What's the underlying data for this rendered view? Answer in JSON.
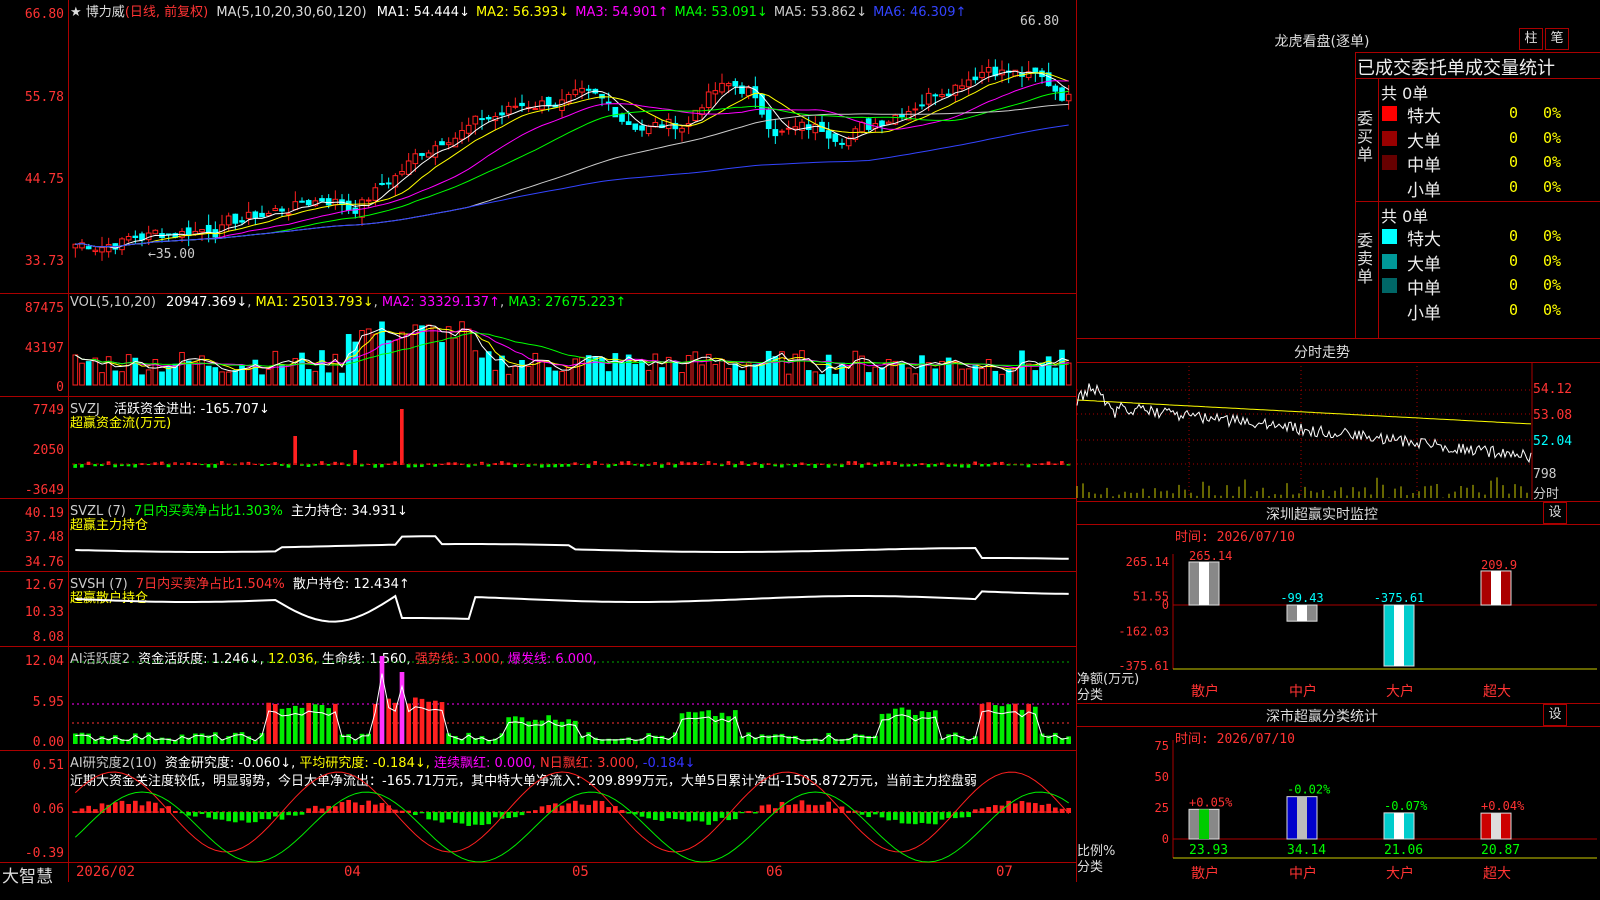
{
  "app_name": "大智慧",
  "stock": {
    "name": "博力威",
    "period": "(日线, 前复权)"
  },
  "main_panel": {
    "ma_legend": "MA(5,10,20,30,60,120)",
    "ma_items": [
      {
        "label": "MA1: 54.444↓",
        "color": "#ffffff"
      },
      {
        "label": "MA2: 56.393↓",
        "color": "#ffff00"
      },
      {
        "label": "MA3: 54.901↑",
        "color": "#ff00ff"
      },
      {
        "label": "MA4: 53.091↓",
        "color": "#00ff00"
      },
      {
        "label": "MA5: 53.862↓",
        "color": "#cccccc"
      },
      {
        "label": "MA6: 46.309↑",
        "color": "#3344ff"
      }
    ],
    "yticks": [
      "66.80",
      "55.78",
      "44.75",
      "33.73"
    ],
    "high_label": "66.80",
    "low_label": "←35.00",
    "y_range": [
      33.0,
      68.0
    ]
  },
  "vol_panel": {
    "label": "VOL(5,10,20)",
    "value": "20947.369↓",
    "ma1": "MA1: 25013.793↓",
    "ma2": "MA2: 33329.137↑",
    "ma3": "MA3: 27675.223↑",
    "yticks": [
      "87475",
      "43197",
      "0"
    ]
  },
  "svzj_panel": {
    "label": "SVZJ",
    "title": "活跃资金进出: -165.707↓",
    "subtitle": "超赢资金流(万元)",
    "yticks": [
      "7749",
      "2050",
      "-3649"
    ]
  },
  "svzl_panel": {
    "label": "SVZL (7)",
    "a": "7日内买卖净占比1.303%",
    "b": "主力持仓: 34.931↓",
    "subtitle": "超赢主力持仓",
    "yticks": [
      "40.19",
      "37.48",
      "34.76"
    ]
  },
  "svsh_panel": {
    "label": "SVSH (7)",
    "a": "7日内买卖净占比1.504%",
    "b": "散户持仓: 12.434↑",
    "subtitle": "超赢散户持仓",
    "yticks": [
      "12.67",
      "10.33",
      "8.08"
    ]
  },
  "ai_act_panel": {
    "label": "AI活跃度2",
    "a": "资金活跃度: 1.246↓,",
    "b": "12.036,",
    "c": "生命线: 1.560,",
    "d": "强势线: 3.000,",
    "e": "爆发线: 6.000,",
    "yticks": [
      "12.04",
      "5.95",
      "0.00"
    ]
  },
  "ai_res_panel": {
    "label": "AI研究度2(10)",
    "a": "资金研究度: -0.060↓,",
    "b": "平均研究度: -0.184↓,",
    "c": "连续飘红: 0.000,",
    "d": "N日飘红: 3.000,",
    "e": "-0.184↓",
    "note": "近期大资金关注度较低，明显弱势，今日大单净流出：-165.71万元，其中特大单净流入：209.899万元，大单5日累计净出-1505.872万元，当前主力控盘弱",
    "yticks": [
      "0.51",
      "0.06",
      "-0.39"
    ]
  },
  "x_labels": [
    "2026/02",
    "04",
    "05",
    "06",
    "07"
  ],
  "right_panel": {
    "longhu_title": "龙虎看盘(逐单)",
    "btn_a": "柱",
    "btn_b": "笔",
    "table_header": "已成交委托单成交量统计",
    "buy_label": "委买单",
    "sell_label": "委卖单",
    "buy_total": "共 0单",
    "sell_total": "共 0单",
    "buy_rows": [
      {
        "name": "特大",
        "n": "0",
        "p": "0%",
        "color": "#ff0000"
      },
      {
        "name": "大单",
        "n": "0",
        "p": "0%",
        "color": "#990000"
      },
      {
        "name": "中单",
        "n": "0",
        "p": "0%",
        "color": "#660000"
      },
      {
        "name": "小单",
        "n": "0",
        "p": "0%",
        "color": "#000000"
      }
    ],
    "sell_rows": [
      {
        "name": "特大",
        "n": "0",
        "p": "0%",
        "color": "#00ffff"
      },
      {
        "name": "大单",
        "n": "0",
        "p": "0%",
        "color": "#009999"
      },
      {
        "name": "中单",
        "n": "0",
        "p": "0%",
        "color": "#006666"
      },
      {
        "name": "小单",
        "n": "0",
        "p": "0%",
        "color": "#000000"
      }
    ],
    "fenshi_title": "分时走势",
    "fenshi_yticks": [
      "54.12",
      "53.08",
      "52.04"
    ],
    "fenshi_vol_label": "798",
    "fenshi_vol_unit": "分时",
    "monitor_title": "深圳超赢实时监控",
    "monitor_btn": "设",
    "monitor_time": "时间: 2026/07/10",
    "monitor_yticks": [
      "265.14",
      "51.55",
      "0",
      "-162.03",
      "-375.61"
    ],
    "monitor_ylabel": "净额(万元)",
    "monitor_xlabel": "分类",
    "stat_title": "深市超赢分类统计",
    "stat_btn": "设",
    "stat_time": "时间: 2026/07/10",
    "stat_yticks": [
      "75",
      "50",
      "25",
      "0"
    ],
    "stat_ylabel": "比例%",
    "stat_xlabel": "分类",
    "stat_delta": [
      "+0.05%",
      "-0.02%",
      "-0.07%",
      "+0.04%"
    ]
  },
  "chart_data": [
    {
      "type": "bar",
      "title": "深圳超赢实时监控",
      "ylabel": "净额(万元)",
      "categories": [
        "散户",
        "中户",
        "大户",
        "超大"
      ],
      "values": [
        265.14,
        -99.43,
        -375.61,
        209.9
      ],
      "ylim": [
        -375.61,
        265.14
      ]
    },
    {
      "type": "bar",
      "title": "深市超赢分类统计",
      "ylabel": "比例%",
      "categories": [
        "散户",
        "中户",
        "大户",
        "超大"
      ],
      "values": [
        23.93,
        34.14,
        21.06,
        20.87
      ],
      "ylim": [
        0,
        75
      ]
    }
  ]
}
